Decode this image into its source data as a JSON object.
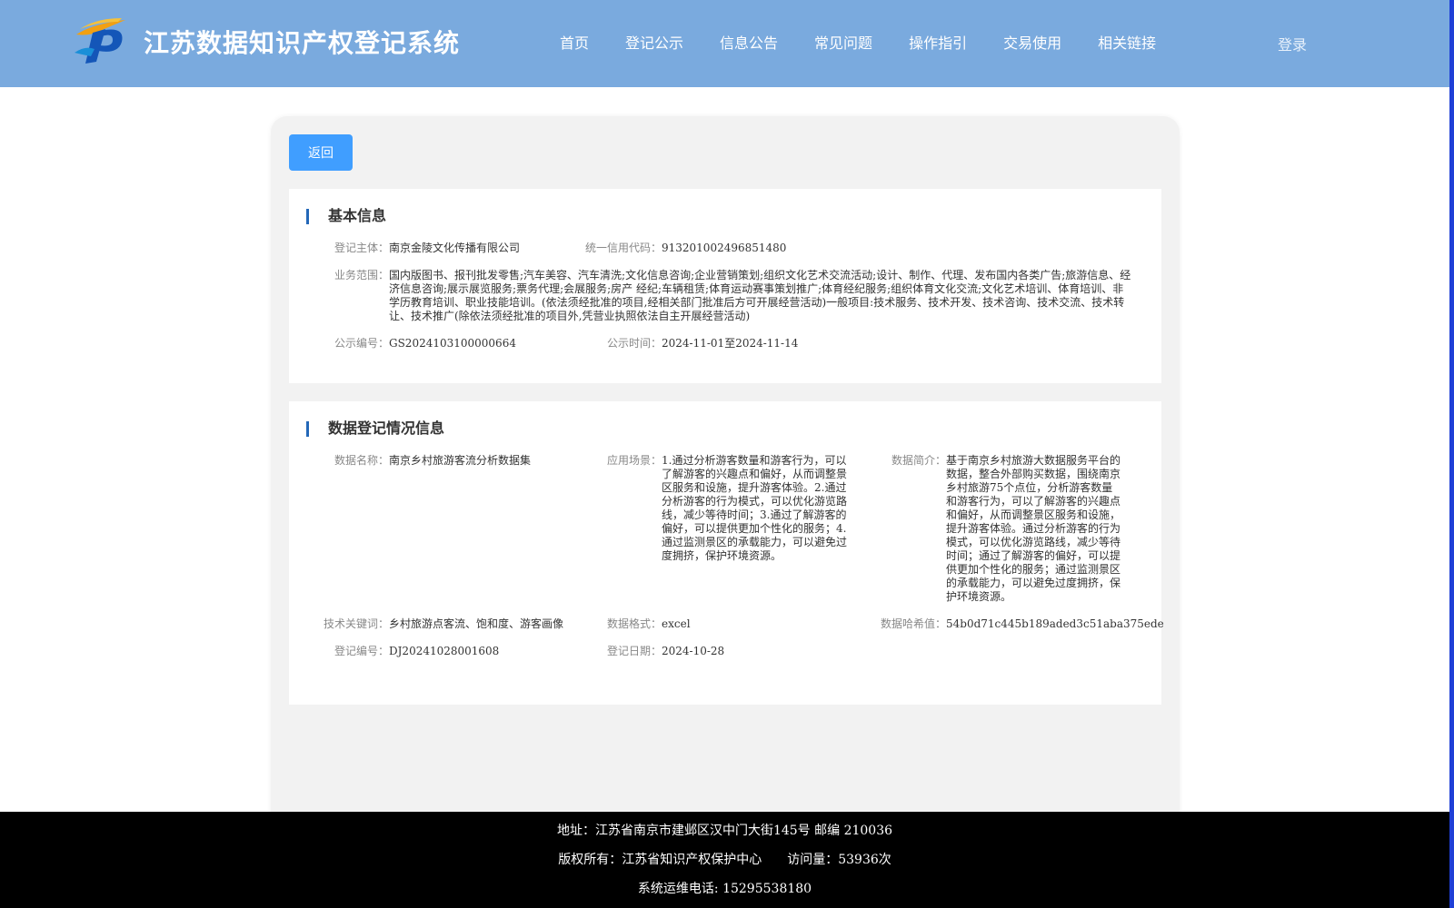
{
  "header": {
    "title": "江苏数据知识产权登记系统",
    "nav": [
      "首页",
      "登记公示",
      "信息公告",
      "常见问题",
      "操作指引",
      "交易使用",
      "相关链接"
    ],
    "login": "登录"
  },
  "back_button": "返回",
  "basic_info": {
    "title": "基本信息",
    "subject_label": "登记主体：",
    "subject_value": "南京金陵文化传播有限公司",
    "credit_label": "统一信用代码：",
    "credit_value": "913201002496851480",
    "scope_label": "业务范围：",
    "scope_value": "国内版图书、报刊批发零售;汽车美容、汽车清洗;文化信息咨询;企业营销策划;组织文化艺术交流活动;设计、制作、代理、发布国内各类广告;旅游信息、经济信息咨询;展示展览服务;票务代理;会展服务;房产 经纪;车辆租赁;体育运动赛事策划推广;体育经纪服务;组织体育文化交流;文化艺术培训、体育培训、非学历教育培训、职业技能培训。(依法须经批准的项目,经相关部门批准后方可开展经营活动)一般项目:技术服务、技术开发、技术咨询、技术交流、技术转让、技术推广(除依法须经批准的项目外,凭营业执照依法自主开展经营活动)",
    "notice_no_label": "公示编号：",
    "notice_no_value": "GS2024103100000664",
    "notice_time_label": "公示时间：",
    "notice_time_value": "2024-11-01至2024-11-14"
  },
  "data_info": {
    "title": "数据登记情况信息",
    "name_label": "数据名称：",
    "name_value": "南京乡村旅游客流分析数据集",
    "scene_label": "应用场景：",
    "scene_value": "1.通过分析游客数量和游客行为，可以了解游客的兴趣点和偏好，从而调整景区服务和设施，提升游客体验。2.通过分析游客的行为模式，可以优化游览路线，减少等待时间；3.通过了解游客的偏好，可以提供更加个性化的服务；4.通过监测景区的承载能力，可以避免过度拥挤，保护环境资源。",
    "intro_label": "数据简介：",
    "intro_value": "基于南京乡村旅游大数据服务平台的数据，整合外部购买数据，围绕南京乡村旅游75个点位，分析游客数量和游客行为，可以了解游客的兴趣点和偏好，从而调整景区服务和设施，提升游客体验。通过分析游客的行为模式，可以优化游览路线，减少等待时间；通过了解游客的偏好，可以提供更加个性化的服务；通过监测景区的承载能力，可以避免过度拥挤，保护环境资源。",
    "keywords_label": "技术关键词：",
    "keywords_value": "乡村旅游点客流、饱和度、游客画像",
    "format_label": "数据格式：",
    "format_value": "excel",
    "hash_label": "数据哈希值：",
    "hash_value": "54b0d71c445b189aded3c51aba375ede",
    "reg_no_label": "登记编号：",
    "reg_no_value": "DJ20241028001608",
    "reg_date_label": "登记日期：",
    "reg_date_value": "2024-10-28"
  },
  "footer": {
    "address": "地址：江苏省南京市建邺区汉中门大街145号 邮编 210036",
    "copyright": "版权所有：江苏省知识产权保护中心　　访问量：53936次",
    "phone": "系统运维电话: 15295538180"
  }
}
